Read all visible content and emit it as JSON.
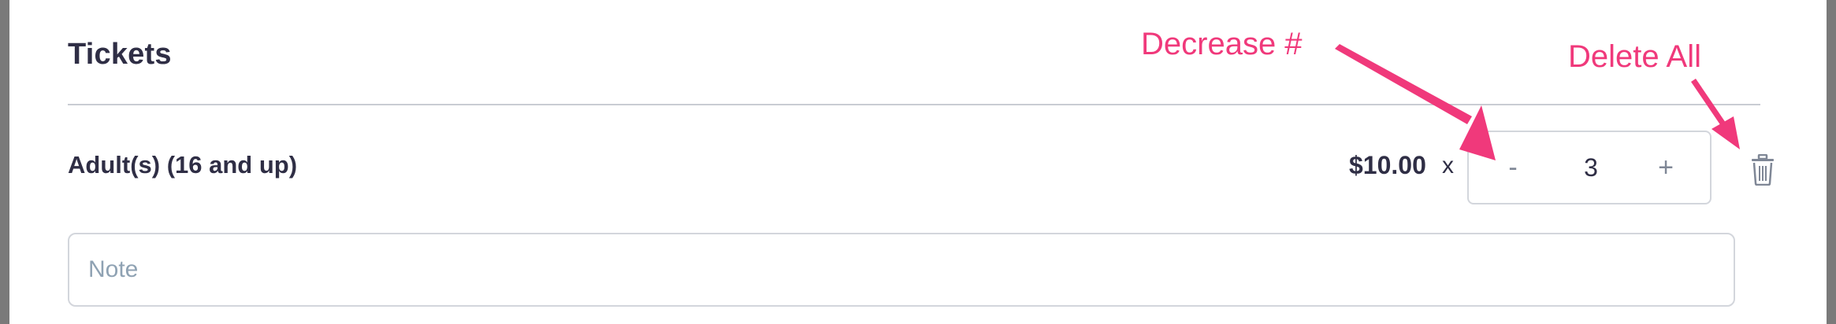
{
  "section": {
    "title": "Tickets"
  },
  "ticket": {
    "label": "Adult(s) (16 and up)",
    "price": "$10.00",
    "times": "x",
    "quantity": "3",
    "minus_label": "-",
    "plus_label": "+"
  },
  "note": {
    "placeholder": "Note",
    "value": ""
  },
  "annotations": {
    "decrease": "Decrease #",
    "delete_all": "Delete All"
  },
  "colors": {
    "annotation": "#f0397b",
    "heading_text": "#2f2e45",
    "muted_icon": "#7f8796",
    "placeholder": "#8fa2b3"
  },
  "icons": {
    "trash": "trash-icon"
  }
}
